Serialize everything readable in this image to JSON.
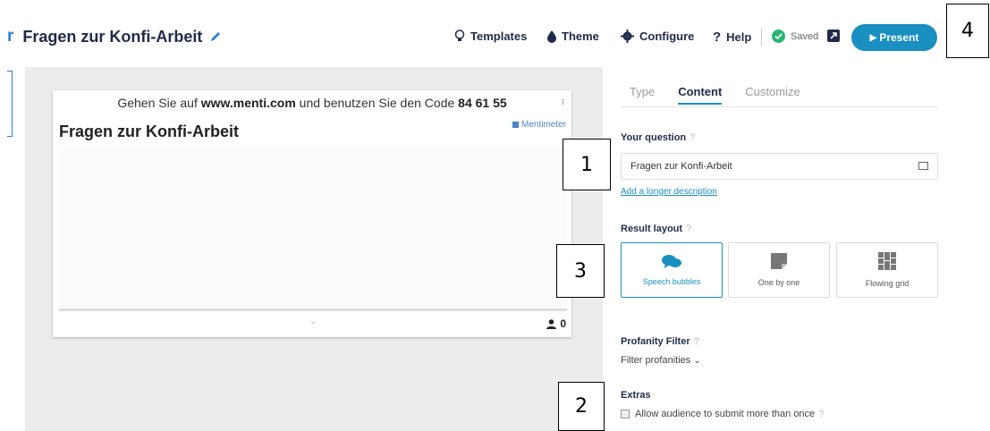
{
  "header": {
    "prefix": "r",
    "title": "Fragen zur Konfi-Arbeit",
    "nav": {
      "templates": "Templates",
      "theme": "Theme",
      "configure": "Configure",
      "help": "Help",
      "saved": "Saved"
    },
    "present": "Present"
  },
  "annotations": [
    "1",
    "2",
    "3",
    "4"
  ],
  "slide": {
    "join_prefix": "Gehen Sie auf ",
    "join_url": "www.menti.com",
    "join_middle": " und benutzen Sie den Code ",
    "join_code": "84 61 55",
    "menu_dots": "⁝",
    "brand": "Mentimeter",
    "title": "Fragen zur Konfi-Arbeit",
    "participants": "0"
  },
  "panel": {
    "tabs": [
      "Type",
      "Content",
      "Customize"
    ],
    "active_tab": "Content",
    "question_label": "Your question",
    "help_mark": "?",
    "question_value": "Fragen zur Konfi-Arbeit",
    "longer_desc": "Add a longer description",
    "result_layout_label": "Result layout",
    "layouts": [
      "Speech bubbles",
      "One by one",
      "Flowing grid"
    ],
    "active_layout": "Speech bubbles",
    "profanity_label": "Profanity Filter",
    "profanity_toggle": "Filter profanities",
    "extras_label": "Extras",
    "extras_option": "Allow audience to submit more than once"
  },
  "colors": {
    "accent": "#1a8fc1",
    "brand_blue": "#2a7fd0",
    "stage_bg": "#ececec",
    "saved_check": "#2bb673"
  }
}
